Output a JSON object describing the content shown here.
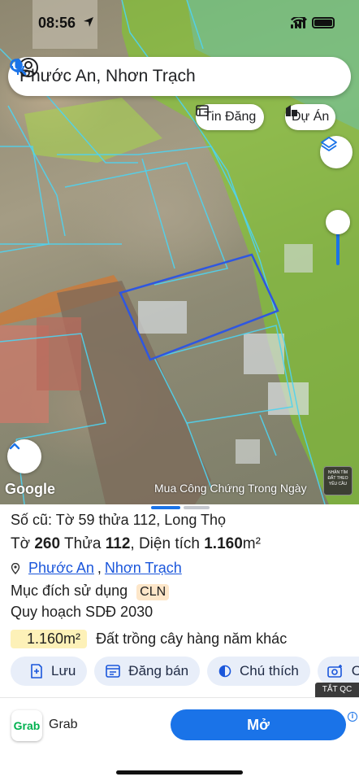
{
  "status": {
    "time": "08:56"
  },
  "search": {
    "query": "Phước An, Nhơn Trạch"
  },
  "chips": {
    "listings_label": "Tin Đăng",
    "projects_label": "Dự Án"
  },
  "map": {
    "attribution": "Google",
    "ad_caption": "Mua Công Chứng Trong Ngày",
    "promo_thumb_text": "NHẬN TÌM ĐẤT THEO YÊU CẦU"
  },
  "parcel": {
    "old_info": "Số cũ: Tờ 59 thửa 112, Long Thọ",
    "sheet_label": "Tờ",
    "sheet_no": "260",
    "parcel_label": "Thửa",
    "parcel_no": "112",
    "area_label": ", Diện tích",
    "area_value": "1.160",
    "area_unit": "m²",
    "ward": "Phước An",
    "separator": ",",
    "district": "Nhơn Trạch",
    "land_use_label": "Mục đích sử dụng",
    "land_use_code": "CLN",
    "plan_label": "Quy hoạch SDĐ 2030",
    "plan_area": "1.160m²",
    "plan_desc": "Đất trồng cây hàng năm khác"
  },
  "actions": [
    {
      "label": "Lưu"
    },
    {
      "label": "Đăng bán"
    },
    {
      "label": "Chú thích"
    },
    {
      "label": "C"
    }
  ],
  "ad": {
    "close_label": "TẮT QC",
    "advertiser": "Grab",
    "logo_text": "Grab",
    "open_label": "Mở",
    "info": "i"
  },
  "colors": {
    "accent": "#1a73e8",
    "parcel_outline": "#2f57e0",
    "zone_green": "#7ed321",
    "boundary_cyan": "#4fd3f0"
  }
}
